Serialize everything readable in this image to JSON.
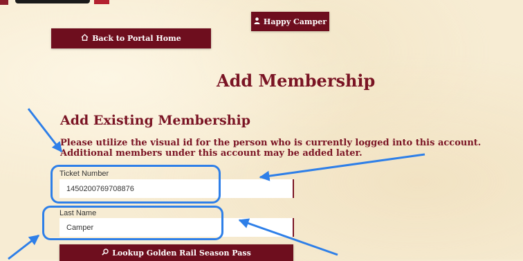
{
  "header": {
    "user_name": "Happy Camper",
    "user_icon": "user-icon",
    "back_label": "Back to Portal Home",
    "back_icon": "home-icon"
  },
  "main": {
    "title": "Add Membership",
    "section_title": "Add Existing Membership",
    "instructions": "Please utilize the visual id for the person who is currently logged into this account. Additional members under this account may be added later."
  },
  "form": {
    "ticket_label": "Ticket Number",
    "ticket_value": "1450200769708876",
    "lastname_label": "Last Name",
    "lastname_value": "Camper",
    "lookup_label": "Lookup Golden Rail Season Pass",
    "lookup_icon": "search-icon"
  },
  "annotations": {
    "highlight_color": "#2e7fe8",
    "arrow_color": "#2e7fe8"
  },
  "colors": {
    "brand": "#6e0e1e",
    "heading": "#7a1424",
    "background": "#f7ecd3"
  }
}
